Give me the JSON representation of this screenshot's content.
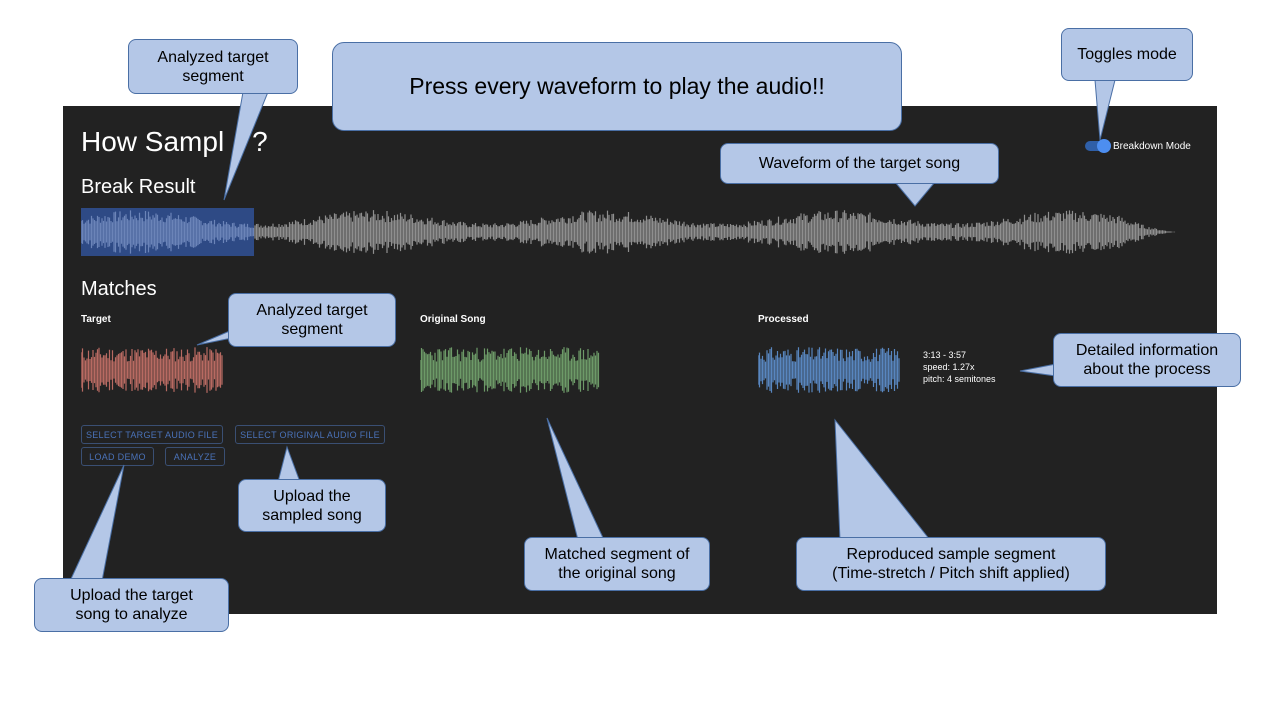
{
  "app": {
    "title": "How Sampl",
    "title_suffix": "?",
    "break_result_heading": "Break Result",
    "matches_heading": "Matches",
    "breakdown_mode_label": "Breakdown Mode",
    "breakdown_mode_on": true
  },
  "matches": {
    "target_label": "Target",
    "original_label": "Original Song",
    "processed_label": "Processed",
    "info": {
      "time_range": "3:13 - 3:57",
      "speed": "speed: 1.27x",
      "pitch": "pitch: 4 semitones"
    }
  },
  "buttons": {
    "select_target": "SELECT TARGET AUDIO FILE",
    "select_original": "SELECT ORIGINAL AUDIO FILE",
    "load_demo": "LOAD DEMO",
    "analyze": "ANALYZE"
  },
  "colors": {
    "background": "#222222",
    "waveform_main": "#8f8f8f",
    "waveform_highlight": "#6b84b8",
    "highlight_bg": "#2e4a85",
    "target_wave": "#b86a62",
    "original_wave": "#6d9a68",
    "processed_wave": "#5886bf",
    "callout_fill": "#b4c7e7",
    "toggle_accent": "#4d8ef0"
  },
  "callouts": {
    "analyzed_target_top": [
      "Analyzed target",
      "segment"
    ],
    "press_every": "Press every waveform to play the audio!!",
    "toggles_mode": "Toggles mode",
    "waveform_target": "Waveform of the target song",
    "analyzed_target_mid": [
      "Analyzed target",
      "segment"
    ],
    "detailed_info": [
      "Detailed information",
      "about the process"
    ],
    "upload_sampled": [
      "Upload the",
      "sampled song"
    ],
    "matched_segment": [
      "Matched segment of",
      "the original song"
    ],
    "reproduced_sample": [
      "Reproduced sample segment",
      "(Time-stretch / Pitch shift applied)"
    ],
    "upload_target": [
      "Upload the target",
      "song to analyze"
    ]
  }
}
